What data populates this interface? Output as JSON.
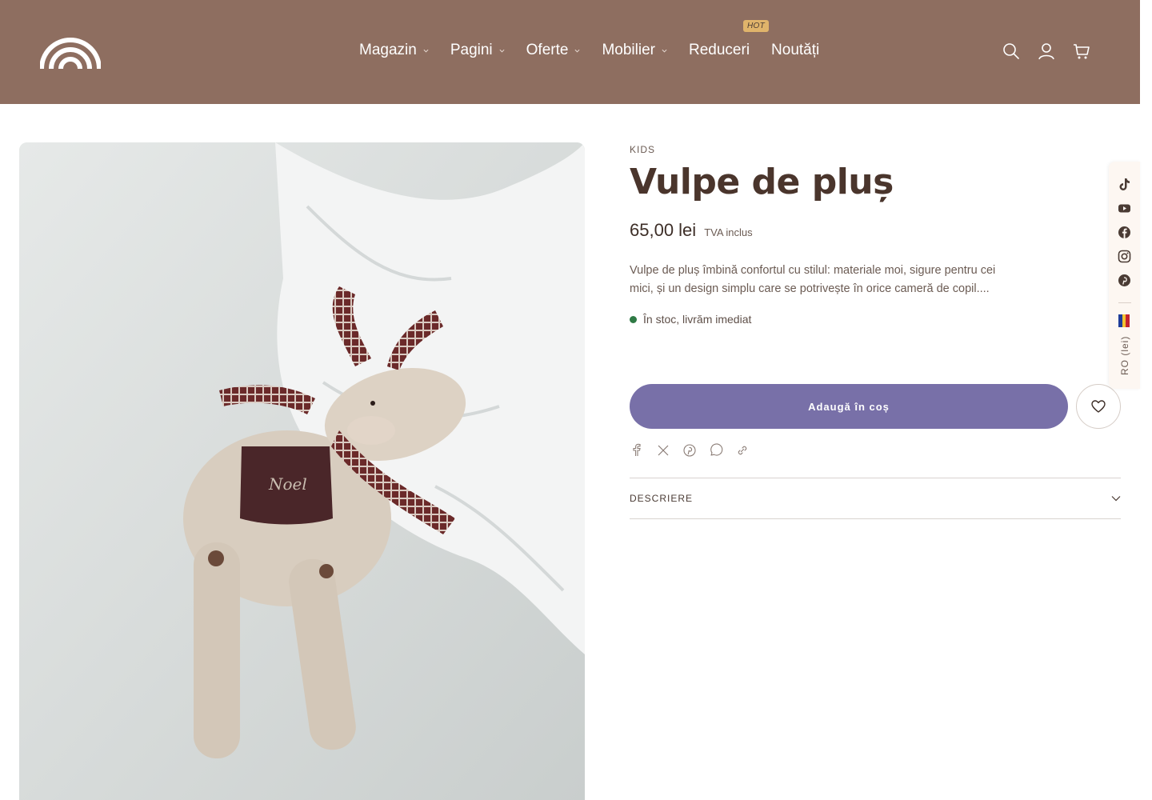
{
  "header": {
    "nav": [
      {
        "label": "Magazin",
        "has_dropdown": true
      },
      {
        "label": "Pagini",
        "has_dropdown": true
      },
      {
        "label": "Oferte",
        "has_dropdown": true
      },
      {
        "label": "Mobilier",
        "has_dropdown": true
      },
      {
        "label": "Reduceri",
        "has_dropdown": false,
        "badge": "HOT"
      },
      {
        "label": "Noutăți",
        "has_dropdown": false
      }
    ],
    "icons": [
      "search-icon",
      "account-icon",
      "cart-icon"
    ]
  },
  "product": {
    "vendor": "KIDS",
    "title": "Vulpe de pluș",
    "price": "65,00 lei",
    "tax_note": "TVA inclus",
    "description": "Vulpe de pluș îmbină confortul cu stilul: materiale moi, sigure pentru cei mici, și un design simplu care se potrivește în orice cameră de copil....",
    "stock": "În stoc, livrăm imediat",
    "add_to_cart": "Adaugă în coș",
    "accordion_label": "DESCRIERE",
    "image_text": "Noel"
  },
  "share_icons": [
    "facebook-icon",
    "x-icon",
    "pinterest-icon",
    "whatsapp-icon",
    "link-icon"
  ],
  "rail": {
    "icons": [
      "tiktok-icon",
      "youtube-icon",
      "facebook-icon",
      "instagram-icon",
      "pinterest-icon"
    ],
    "language": "RO (lei)"
  },
  "colors": {
    "header_bg": "#8e6e60",
    "button_bg": "#7870a8",
    "hot_badge": "#e0b46b",
    "stock_dot": "#2f7a45"
  }
}
